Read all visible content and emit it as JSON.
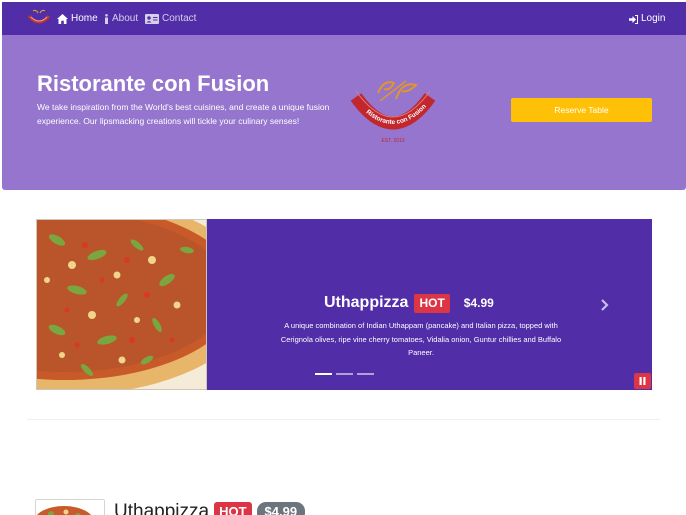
{
  "navbar": {
    "brand_icon": "restaurant-logo",
    "items": [
      {
        "label": "Home",
        "icon": "home-icon",
        "active": true
      },
      {
        "label": "About",
        "icon": "info-icon",
        "active": false
      },
      {
        "label": "Contact",
        "icon": "address-card-icon",
        "active": false
      }
    ],
    "login_label": "Login",
    "login_icon": "sign-in-icon"
  },
  "jumbotron": {
    "title": "Ristorante con Fusion",
    "description": "We take inspiration from the World's best cuisines, and create a unique fusion experience. Our lipsmacking creations will tickle your culinary senses!",
    "logo_text": "Ristorante con Fusion",
    "logo_est": "EST. 2013",
    "reserve_label": "Reserve Table"
  },
  "carousel": {
    "slide": {
      "name": "Uthappizza",
      "badge": "HOT",
      "price": "$4.99",
      "description": "A unique combination of Indian Uthappam (pancake) and Italian pizza, topped with Cerignola olives, ripe vine cherry tomatoes, Vidalia onion, Guntur chillies and Buffalo Paneer."
    },
    "indicator_count": 3,
    "active_indicator": 0
  },
  "media": {
    "name": "Uthappizza",
    "badge": "HOT",
    "price": "$4.99"
  },
  "colors": {
    "primary": "#512DA8",
    "primary_light": "#9575CD",
    "accent": "#FFC107",
    "danger": "#DC3545",
    "secondary": "#6c757d"
  }
}
